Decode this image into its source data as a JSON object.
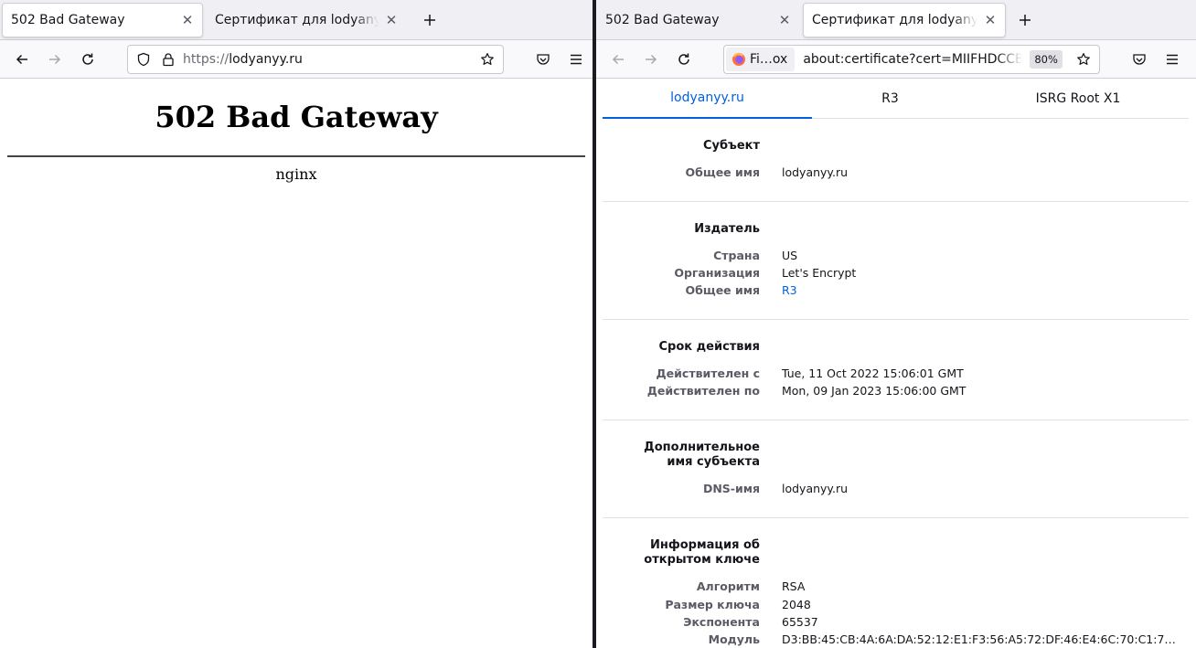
{
  "left_window": {
    "tabs": [
      {
        "title": "502 Bad Gateway",
        "selected": true
      },
      {
        "title": "Сертификат для lodyanyy.ru",
        "selected": false
      }
    ],
    "url": {
      "protocol": "https://",
      "host": "lodyanyy.ru"
    },
    "page": {
      "heading": "502 Bad Gateway",
      "footer": "nginx"
    }
  },
  "right_window": {
    "tabs": [
      {
        "title": "502 Bad Gateway",
        "selected": false
      },
      {
        "title": "Сертификат для lodyanyy.ru",
        "selected": true
      }
    ],
    "identity_label": "Fi…ox",
    "url": "about:certificate?cert=MIIFHDCCBAS",
    "zoom": "80%",
    "cert_tabs": [
      "lodyanyy.ru",
      "R3",
      "ISRG Root X1"
    ],
    "subject": {
      "title": "Субъект",
      "rows": [
        {
          "label": "Общее имя",
          "value": "lodyanyy.ru"
        }
      ]
    },
    "issuer": {
      "title": "Издатель",
      "rows": [
        {
          "label": "Страна",
          "value": "US"
        },
        {
          "label": "Организация",
          "value": "Let's Encrypt"
        },
        {
          "label": "Общее имя",
          "value": "R3"
        }
      ]
    },
    "validity": {
      "title": "Срок действия",
      "rows": [
        {
          "label": "Действителен с",
          "value": "Tue, 11 Oct 2022 15:06:01 GMT"
        },
        {
          "label": "Действителен по",
          "value": "Mon, 09 Jan 2023 15:06:00 GMT"
        }
      ]
    },
    "san": {
      "title_line1": "Дополнительное",
      "title_line2": "имя субъекта",
      "rows": [
        {
          "label": "DNS-имя",
          "value": "lodyanyy.ru"
        }
      ]
    },
    "public_key": {
      "title_line1": "Информация об",
      "title_line2": "открытом ключе",
      "rows": [
        {
          "label": "Алгоритм",
          "value": "RSA"
        },
        {
          "label": "Размер ключа",
          "value": "2048"
        },
        {
          "label": "Экспонента",
          "value": "65537"
        },
        {
          "label": "Модуль",
          "value": "D3:BB:45:CB:4A:6A:DA:52:12:E1:F3:56:A5:72:DF:46:E4:6C:70:C1:7…"
        }
      ]
    }
  },
  "colors": {
    "accent": "#0061e0",
    "chrome": "#f0f0f4",
    "separator": "#1c1b22"
  }
}
